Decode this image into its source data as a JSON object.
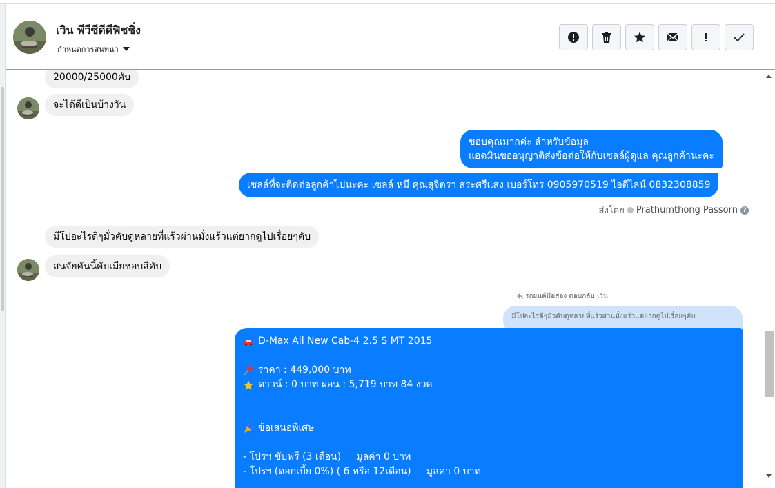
{
  "contact": {
    "name": "เวิน พีวีซีดีดีฟิชชิ่ง",
    "conversation_settings": "กำหนดการสนทนา"
  },
  "actions": [
    {
      "name": "report-icon"
    },
    {
      "name": "trash-icon"
    },
    {
      "name": "star-icon"
    },
    {
      "name": "mail-icon"
    },
    {
      "name": "exclamation-icon"
    },
    {
      "name": "check-icon"
    }
  ],
  "messages": {
    "m1": "20000/25000คับ",
    "m2": "จะได้ดีเป็นบ้างวัน",
    "m3_line1": "ขอบคุณมากค่ะ สำหรับข้อมูล",
    "m3_line2": "แอดมินขออนุญาติส่งข้อต่อให้กับเซลล์ผู้ดูแล คุณลูกค้านะคะ",
    "m4": "เซลล์ที่จะติดต่อลูกค้าไปนะคะ เซลล์ หมี คุณสุจิตรา สระศรีแสง เบอร์โทร 0905970519 ไอดีไลน์ 0832308859",
    "sent_by_label": "ส่งโดย",
    "sent_by_name": "Prathumthong Passorn",
    "m5": "มีโปอะไรดีๆมั่วคับดูหลายที่แร้วผ่านมั่งแร้วแต่ยากดูไปเรื่อยๆคับ",
    "m6": "สนจัยคันนี้คับเมียชอบสีคับ",
    "reply_meta": "รถยนต์มือสอง ตอบกลับ เวิน",
    "quoted_text": "มีโปอะไรดีๆมั่วคับดูหลายที่แร้วผ่านมั่งแร้วแต่ยากดูไปเรื่อยๆคับ"
  },
  "offer": {
    "model": "D-Max All New Cab-4 2.5 S MT 2015",
    "price": "ราคา : 449,000 บาท",
    "down": "ดาวน์ : 0 บาท ผ่อน : 5,719 บาท 84 งวด",
    "special_title": "ข้อเสนอพิเศษ",
    "promo1": "- โปรฯ ขับฟรี (3 เดือน)     มูลค่า 0 บาท",
    "promo2": "- โปรฯ (ดอกเบี้ย 0%) ( 6 หรือ 12เดือน)     มูลค่า 0 บาท"
  },
  "colors": {
    "outgoing_bubble": "#0a7cff",
    "incoming_bubble": "#f0f0f0",
    "quoted_bubble": "#cfe3fb"
  }
}
